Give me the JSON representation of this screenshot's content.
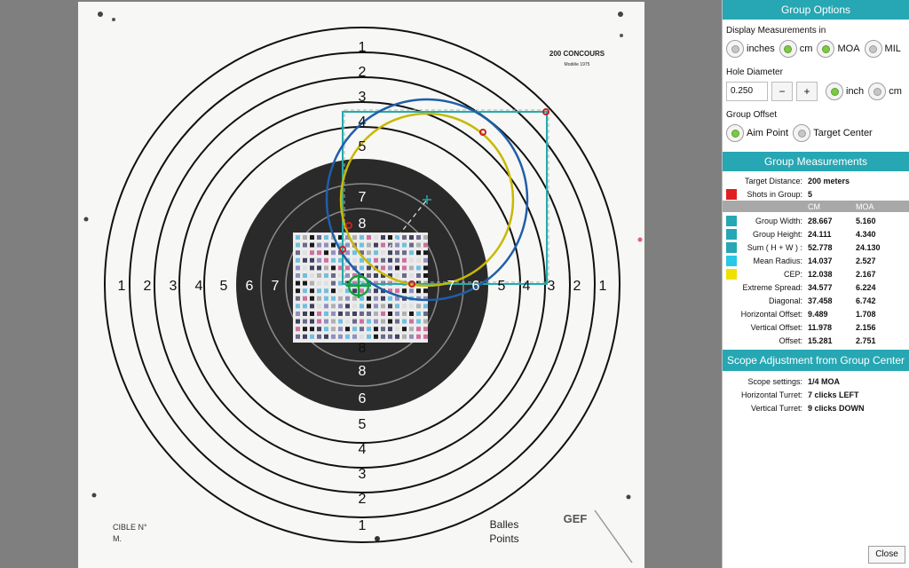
{
  "target": {
    "ring_numbers_top": [
      "1",
      "2",
      "3",
      "4",
      "5"
    ],
    "ring_numbers_inner": [
      "7",
      "8"
    ],
    "ring_numbers_bottom": [
      "8",
      "8",
      "6",
      "5",
      "4",
      "3",
      "2",
      "1"
    ],
    "ring_numbers_left": [
      "1",
      "2",
      "3",
      "4",
      "5",
      "6",
      "7"
    ],
    "ring_numbers_right": [
      "7",
      "6",
      "5",
      "4",
      "3",
      "2",
      "1"
    ],
    "brand_title": "200 CONCOURS",
    "brand_subtitle": "Modèle 1975",
    "cible_label": "CIBLE N°",
    "m_label": "M.",
    "balles_label": "Balles",
    "points_label": "Points",
    "gef_label": "GEF"
  },
  "group_options": {
    "header": "Group Options",
    "display_label": "Display Measurements in",
    "units": [
      {
        "label": "inches",
        "selected": false
      },
      {
        "label": "cm",
        "selected": true
      },
      {
        "label": "MOA",
        "selected": true
      },
      {
        "label": "MIL",
        "selected": false
      }
    ],
    "hole_label": "Hole Diameter",
    "hole_value": "0.250",
    "minus": "−",
    "plus": "+",
    "hole_units": [
      {
        "label": "inch",
        "selected": true
      },
      {
        "label": "cm",
        "selected": false
      }
    ],
    "offset_label": "Group Offset",
    "offset_options": [
      {
        "label": "Aim Point",
        "selected": true
      },
      {
        "label": "Target Center",
        "selected": false
      }
    ]
  },
  "group_measurements": {
    "header": "Group Measurements",
    "target_distance_label": "Target Distance:",
    "target_distance_value": "200 meters",
    "shots_label": "Shots in Group:",
    "shots_value": "5",
    "shots_color": "#e02020",
    "col_cm": "CM",
    "col_moa": "MOA",
    "rows": [
      {
        "label": "Group Width:",
        "cm": "28.667",
        "moa": "5.160",
        "color": "#26a7b3"
      },
      {
        "label": "Group Height:",
        "cm": "24.111",
        "moa": "4.340",
        "color": "#26a7b3"
      },
      {
        "label": "Sum ( H + W ) :",
        "cm": "52.778",
        "moa": "24.130",
        "color": "#26a7b3"
      },
      {
        "label": "Mean Radius:",
        "cm": "14.037",
        "moa": "2.527",
        "color": "#28c8e6"
      },
      {
        "label": "CEP:",
        "cm": "12.038",
        "moa": "2.167",
        "color": "#f0e000"
      },
      {
        "label": "Extreme Spread:",
        "cm": "34.577",
        "moa": "6.224",
        "color": ""
      },
      {
        "label": "Diagonal:",
        "cm": "37.458",
        "moa": "6.742",
        "color": ""
      },
      {
        "label": "Horizontal Offset:",
        "cm": "9.489",
        "moa": "1.708",
        "color": ""
      },
      {
        "label": "Vertical Offset:",
        "cm": "11.978",
        "moa": "2.156",
        "color": ""
      },
      {
        "label": "Offset:",
        "cm": "15.281",
        "moa": "2.751",
        "color": ""
      }
    ]
  },
  "scope": {
    "header": "Scope Adjustment from Group Center",
    "rows": [
      {
        "label": "Scope settings:",
        "value": "1/4 MOA"
      },
      {
        "label": "Horizontal Turret:",
        "value": "7 clicks LEFT"
      },
      {
        "label": "Vertical Turret:",
        "value": "9 clicks DOWN"
      }
    ]
  },
  "close_label": "Close"
}
